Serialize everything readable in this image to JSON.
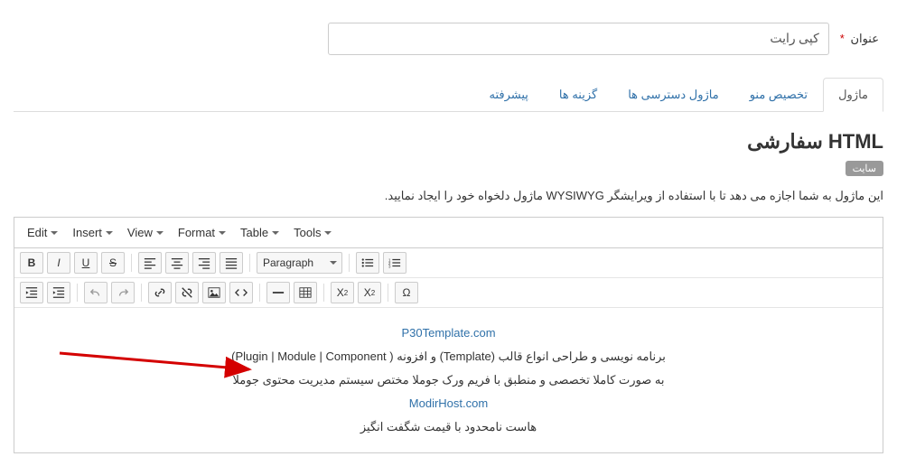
{
  "titleField": {
    "label": "عنوان",
    "value": "کپی رایت"
  },
  "tabs": [
    {
      "label": "ماژول",
      "active": true
    },
    {
      "label": "تخصیص منو",
      "active": false
    },
    {
      "label": "ماژول دسترسی ها",
      "active": false
    },
    {
      "label": "گزینه ها",
      "active": false
    },
    {
      "label": "پیشرفته",
      "active": false
    }
  ],
  "section": {
    "title": "HTML سفارشی",
    "badge": "سایت",
    "desc": "این ماژول به شما اجازه می دهد تا با استفاده از ویرایشگر WYSIWYG ماژول دلخواه خود را ایجاد نمایید."
  },
  "editor": {
    "menu": [
      "Edit",
      "Insert",
      "View",
      "Format",
      "Table",
      "Tools"
    ],
    "formatSelect": "Paragraph"
  },
  "content": {
    "link1": "P30Template.com",
    "line1": "برنامه نویسی و طراحی انواع قالب (Template) و افزونه ( Plugin | Module | Component)",
    "line2": "به صورت کاملا تخصصی و منطبق با فریم ورک جوملا مختص سیستم مدیریت محتوی جوملا",
    "link2": "ModirHost.com",
    "line3": "هاست نامحدود با قیمت شگفت انگیز"
  }
}
